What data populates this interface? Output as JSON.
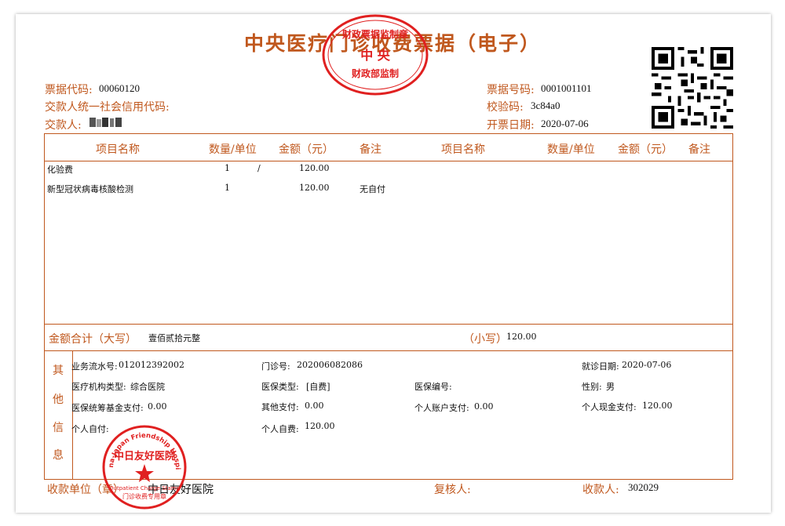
{
  "header": {
    "title": "中央医疗门诊收费票据（电子）",
    "bill_code_label": "票据代码:",
    "bill_code": "00060120",
    "payer_credit_label": "交款人统一社会信用代码:",
    "payer_label": "交款人:",
    "bill_no_label": "票据号码:",
    "bill_no": "0001001101",
    "check_code_label": "校验码:",
    "check_code": "3c84a0",
    "issue_date_label": "开票日期:",
    "issue_date": "2020-07-06"
  },
  "table": {
    "columns": [
      "项目名称",
      "数量/单位",
      "金额（元）",
      "备注",
      "项目名称",
      "数量/单位",
      "金额（元）",
      "备注"
    ],
    "rows": [
      {
        "name": "化验费",
        "qty": "1",
        "unit": "/",
        "amount": "120.00",
        "note": ""
      },
      {
        "name": "新型冠状病毒核酸检测",
        "qty": "1",
        "unit": "",
        "amount": "120.00",
        "note": "无自付"
      }
    ],
    "total_label": "金额合计（大写）",
    "total_upper": "壹佰贰拾元整",
    "small_label": "（小写）",
    "total_small": "120.00"
  },
  "other_info": {
    "side_label": [
      "其",
      "他",
      "信",
      "息"
    ],
    "serial_label": "业务流水号:",
    "serial": "012012392002",
    "outpatient_no_label": "门诊号:",
    "outpatient_no": "202006082086",
    "visit_date_label": "就诊日期:",
    "visit_date": "2020-07-06",
    "org_type_label": "医疗机构类型:",
    "org_type": "综合医院",
    "insurance_type_label": "医保类型:",
    "insurance_type": "[自费]",
    "insurance_no_label": "医保编号:",
    "gender_label": "性别:",
    "gender": "男",
    "pool_fund_label": "医保统筹基金支付:",
    "pool_fund": "0.00",
    "other_pay_label": "其他支付:",
    "other_pay": "0.00",
    "personal_account_label": "个人账户支付:",
    "personal_account": "0.00",
    "personal_cash_label": "个人现金支付:",
    "personal_cash": "120.00",
    "self_pay_label": "个人自付:",
    "self_expense_label": "个人自费:",
    "self_expense": "120.00"
  },
  "footer": {
    "payee_unit_label": "收款单位（章）",
    "payee_unit": "中日友好医院",
    "reviewer_label": "复核人:",
    "collector_label": "收款人:",
    "collector": "302029"
  },
  "stamps": {
    "finance_seal_lines": [
      "财政票据监制章",
      "中央",
      "财政部监制"
    ],
    "hospital_seal_lines": [
      "China-Japan Friendship Hospital",
      "中日友好医院",
      "Outpatient Charge Stamp",
      "门诊收费专用章"
    ]
  },
  "colors": {
    "accent": "#c0581e",
    "seal_red": "#e02020"
  }
}
